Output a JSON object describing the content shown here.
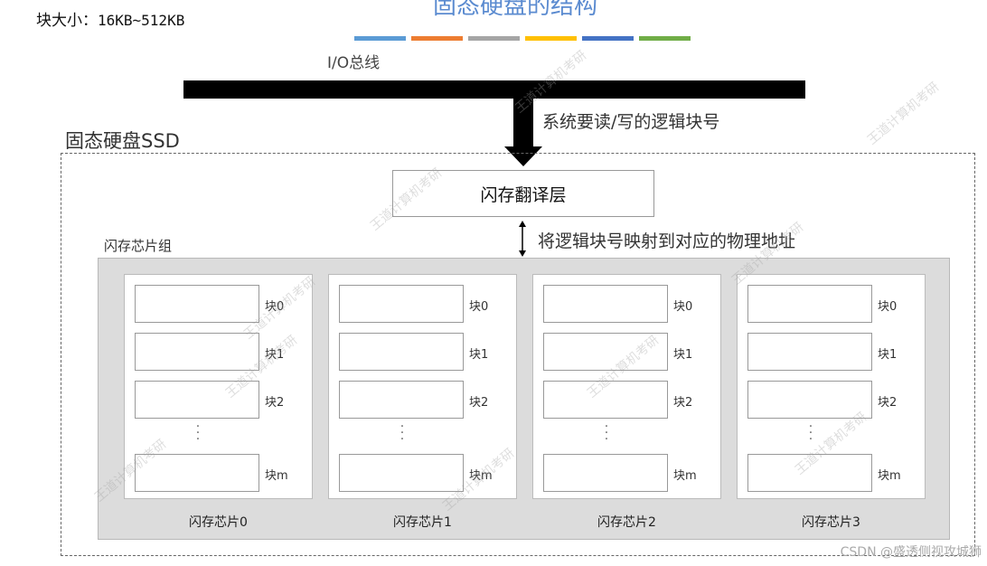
{
  "header": {
    "block_size_label": "块大小：",
    "block_size_value": "16KB~512KB",
    "title": "固态硬盘的结构",
    "stripe_colors": [
      "#5b9bd5",
      "#ed7d31",
      "#a5a5a5",
      "#ffc000",
      "#4472c4",
      "#70ad47"
    ]
  },
  "bus": {
    "label": "I/O总线",
    "request_label": "系统要读/写的逻辑块号"
  },
  "ssd": {
    "label": "固态硬盘SSD",
    "ftl_label": "闪存翻译层",
    "mapping_label": "将逻辑块号映射到对应的物理地址",
    "group_label": "闪存芯片组",
    "chips": [
      {
        "label": "闪存芯片0",
        "blocks": [
          "块0",
          "块1",
          "块2",
          "块m"
        ]
      },
      {
        "label": "闪存芯片1",
        "blocks": [
          "块0",
          "块1",
          "块2",
          "块m"
        ]
      },
      {
        "label": "闪存芯片2",
        "blocks": [
          "块0",
          "块1",
          "块2",
          "块m"
        ]
      },
      {
        "label": "闪存芯片3",
        "blocks": [
          "块0",
          "块1",
          "块2",
          "块m"
        ]
      }
    ]
  },
  "watermark": {
    "text": "王道计算机考研",
    "footer": "CSDN @盛透侧视攻城狮"
  },
  "colors": {
    "title": "#5b8bd0",
    "bus": "#000000",
    "group_bg": "#dcdcdc"
  }
}
